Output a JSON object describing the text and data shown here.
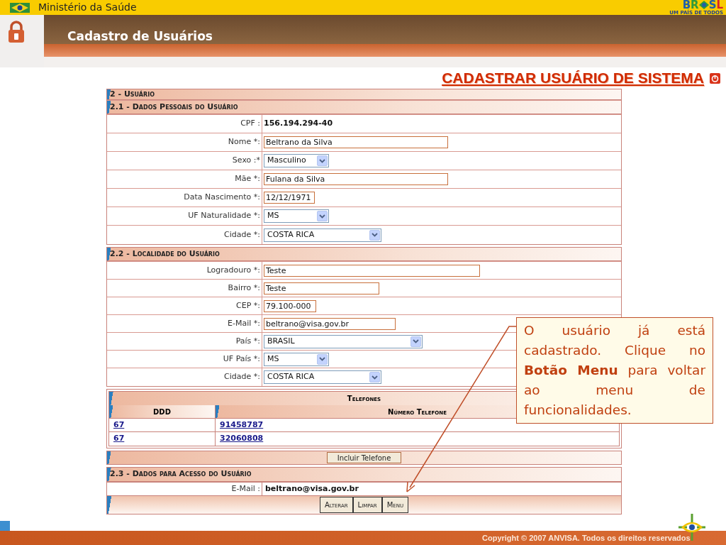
{
  "top_bar": {
    "ministry": "Ministério da Saúde",
    "logo_letters": [
      {
        "letter": "B",
        "color": "#1f5fa8"
      },
      {
        "letter": "R",
        "color": "#2f9a3a"
      },
      {
        "letter": "S",
        "color": "#1f5fa8"
      },
      {
        "letter": "L",
        "color": "#d8232a"
      }
    ],
    "logo_tagline": "UM PAÍS DE TODOS"
  },
  "header": {
    "title": "Cadastro de Usuários"
  },
  "page_title": "CADASTRAR USUÁRIO DE SISTEMA",
  "section_main": "2 - Usuário",
  "sections": [
    {
      "title": "2.1 - Dados Pessoais do Usuário",
      "fields": [
        {
          "kind": "static",
          "label": "CPF :",
          "value": "156.194.294-40"
        },
        {
          "kind": "text",
          "label": "Nome *:",
          "value": "Beltrano da Silva"
        },
        {
          "kind": "select",
          "label": "Sexo :*",
          "value": "Masculino"
        },
        {
          "kind": "text",
          "label": "Mãe *:",
          "value": "Fulana da Silva"
        },
        {
          "kind": "text",
          "label": "Data Nascimento *:",
          "value": "12/12/1971"
        },
        {
          "kind": "select",
          "label": "UF Naturalidade *:",
          "value": "MS"
        },
        {
          "kind": "select",
          "label": "Cidade *:",
          "value": "COSTA RICA"
        }
      ]
    },
    {
      "title": "2.2 - Localidade do Usuário",
      "fields": [
        {
          "kind": "text",
          "label": "Logradouro *:",
          "value": "Teste"
        },
        {
          "kind": "text",
          "label": "Bairro *:",
          "value": "Teste"
        },
        {
          "kind": "text",
          "label": "CEP *:",
          "value": "79.100-000"
        },
        {
          "kind": "text",
          "label": "E-Mail *:",
          "value": "beltrano@visa.gov.br"
        },
        {
          "kind": "select",
          "label": "País *:",
          "value": "BRASIL"
        },
        {
          "kind": "select",
          "label": "UF País *:",
          "value": "MS"
        },
        {
          "kind": "select",
          "label": "Cidade *:",
          "value": "COSTA RICA"
        }
      ]
    }
  ],
  "phones": {
    "title": "Telefones",
    "columns": [
      "DDD",
      "Número Telefone"
    ],
    "rows": [
      {
        "ddd": "67",
        "number": "91458787"
      },
      {
        "ddd": "67",
        "number": "32060808"
      }
    ],
    "add_button": "Incluir Telefone"
  },
  "access": {
    "title": "2.3 - Dados para Acesso do Usuário",
    "label": "E-Mail :",
    "value": "beltrano@visa.gov.br"
  },
  "buttons": [
    "Alterar",
    "Limpar",
    "Menu"
  ],
  "callout": "O usuário já está cadastrado. Clique no **Botão Menu** para voltar ao menu de funcionalidades.",
  "footer": {
    "copyright": "Copyright © 2007 ANVISA. Todos os direitos reservados"
  }
}
